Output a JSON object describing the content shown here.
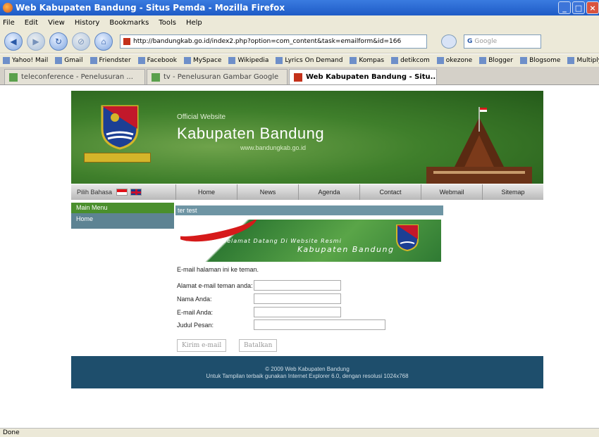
{
  "window": {
    "title": "Web Kabupaten Bandung - Situs Pemda - Mozilla Firefox"
  },
  "menubar": [
    "File",
    "Edit",
    "View",
    "History",
    "Bookmarks",
    "Tools",
    "Help"
  ],
  "toolbar": {
    "url": "http://bandungkab.go.id/index2.php?option=com_content&task=emailform&id=166",
    "search_placeholder": "Google"
  },
  "bookmarks": [
    "Yahoo! Mail",
    "Gmail",
    "Friendster",
    "Facebook",
    "MySpace",
    "Wikipedia",
    "Lyrics On Demand",
    "Kompas",
    "detikcom",
    "okezone",
    "Blogger",
    "Blogsome",
    "Multiply"
  ],
  "tabs": [
    {
      "label": "teleconference - Penelusuran ..."
    },
    {
      "label": "tv - Penelusuran Gambar Google"
    },
    {
      "label": "Web Kabupaten Bandung - Situ..."
    }
  ],
  "header": {
    "official": "Official Website",
    "site_name": "Kabupaten Bandung",
    "site_url": "www.bandungkab.go.id"
  },
  "topnav": {
    "language_label": "Pilih Bahasa",
    "items": [
      "Home",
      "News",
      "Agenda",
      "Contact",
      "Webmail",
      "Sitemap"
    ]
  },
  "leftmenu": {
    "heading": "Main Menu",
    "items": [
      "Home"
    ]
  },
  "content": {
    "title": "ter test",
    "banner_line1": "Selamat Datang Di Website Resmi",
    "banner_line2": "Kabupaten Bandung",
    "intro": "E-mail halaman ini ke teman.",
    "fields": [
      {
        "label": "Alamat e-mail teman anda:"
      },
      {
        "label": "Nama Anda:"
      },
      {
        "label": "E-mail Anda:"
      },
      {
        "label": "Judul Pesan:"
      }
    ],
    "send_button": "Kirim e-mail",
    "cancel_button": "Batalkan"
  },
  "footer": {
    "line1": "© 2009 Web Kabupaten Bandung",
    "line2": "Untuk Tampilan terbaik gunakan Internet Explorer 6.0, dengan resolusi 1024x768"
  },
  "status": "Done"
}
